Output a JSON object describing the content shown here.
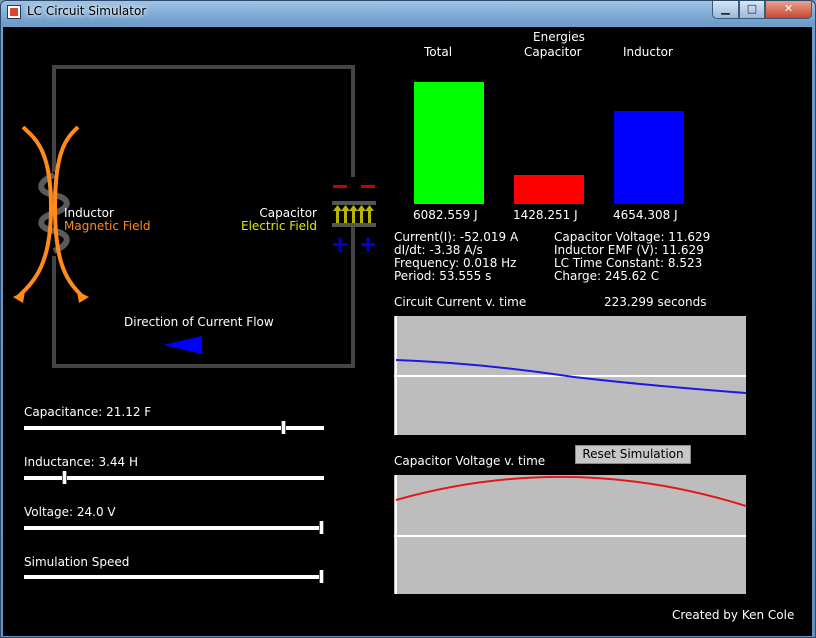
{
  "window": {
    "title": "LC Circuit Simulator"
  },
  "circuit": {
    "inductor_label": "Inductor",
    "inductor_field": "Magnetic Field",
    "capacitor_label": "Capacitor",
    "capacitor_field": "Electric Field",
    "current_flow_label": "Direction of Current Flow"
  },
  "energies": {
    "heading": "Energies",
    "columns": [
      "Total",
      "Capacitor",
      "Inductor"
    ],
    "values": [
      "6082.559 J",
      "1428.251 J",
      "4654.308 J"
    ],
    "numeric": [
      6082.559,
      1428.251,
      4654.308
    ],
    "colors": [
      "#00ff00",
      "#ff0000",
      "#0000ff"
    ]
  },
  "readouts": {
    "left": [
      "Current(I): -52.019 A",
      "dI/dt: -3.38 A/s",
      "Frequency: 0.018 Hz",
      "Period: 53.555 s"
    ],
    "right": [
      "Capacitor Voltage: 11.629",
      "Inductor EMF (V): 11.629",
      "LC Time Constant: 8.523",
      "Charge: 245.62 C"
    ]
  },
  "graphs": {
    "current_title": "Circuit Current v. time",
    "time_label": "223.299 seconds",
    "voltage_title": "Capacitor Voltage v. time"
  },
  "controls": {
    "capacitance_label": "Capacitance: 21.12 F",
    "capacitance_fraction": 0.87,
    "inductance_label": "Inductance: 3.44 H",
    "inductance_fraction": 0.13,
    "voltage_label": "Voltage: 24.0 V",
    "voltage_fraction": 1.0,
    "speed_label": "Simulation Speed",
    "speed_fraction": 1.0,
    "reset_label": "Reset Simulation"
  },
  "footer": {
    "credit": "Created by Ken Cole"
  },
  "colors": {
    "wire": "#444444",
    "field": "#ff8c1a",
    "electric": "#e6e600",
    "plus": "#0000cc",
    "minus": "#cc0000"
  }
}
